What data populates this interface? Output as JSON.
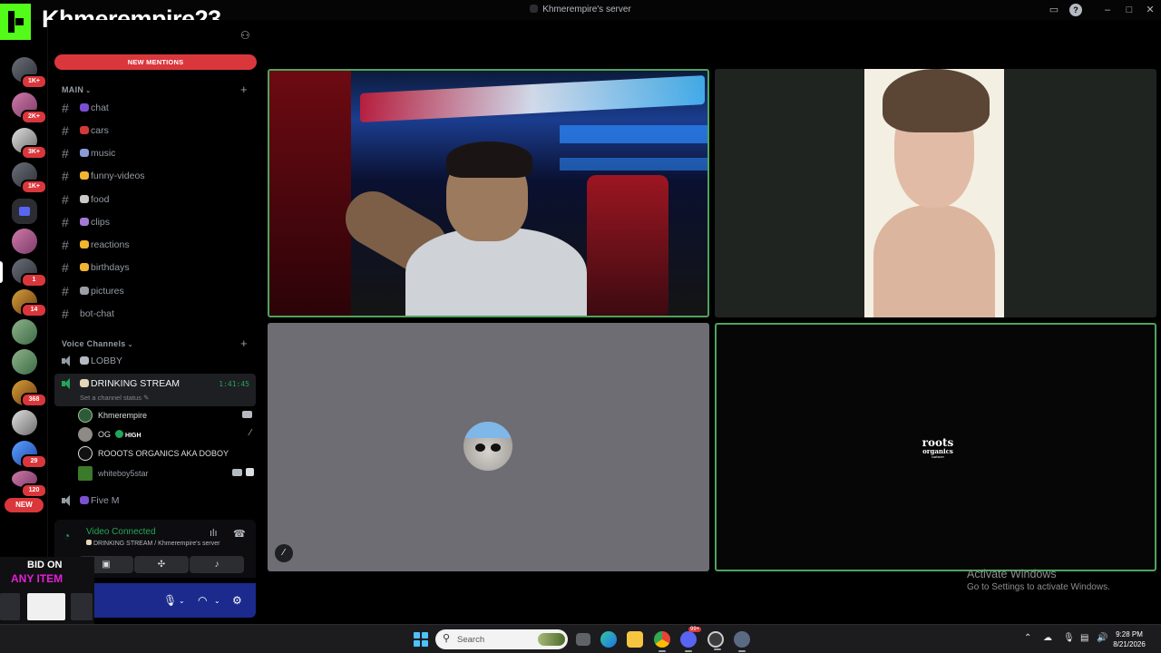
{
  "window": {
    "title": "Khmerempire's server"
  },
  "overlay": {
    "streamer_name": "Khmerempire23",
    "bid_line1": "BID ON",
    "bid_line2": "ANY ITEM"
  },
  "rail": {
    "badges": [
      "1K+",
      "2K+",
      "3K+",
      "1K+",
      "1",
      "14",
      "368",
      "29",
      "120"
    ],
    "new_label": "NEW"
  },
  "sidebar": {
    "new_mentions": "NEW MENTIONS",
    "category_main": "MAIN",
    "text_channels": [
      {
        "name": "chat",
        "emoji_color": "#7b4fd1"
      },
      {
        "name": "cars",
        "emoji_color": "#d23a3a"
      },
      {
        "name": "music",
        "emoji_color": "#8a9ad6"
      },
      {
        "name": "funny-videos",
        "emoji_color": "#f1b531"
      },
      {
        "name": "food",
        "emoji_color": "#c9c9c9"
      },
      {
        "name": "clips",
        "emoji_color": "#a57ad6"
      },
      {
        "name": "reactions",
        "emoji_color": "#f1b531"
      },
      {
        "name": "birthdays",
        "emoji_color": "#f1b531"
      },
      {
        "name": "pictures",
        "emoji_color": "#9aa0a6"
      },
      {
        "name": "bot-chat",
        "emoji_color": ""
      }
    ],
    "category_voice": "Voice Channels",
    "voice_channels": {
      "lobby": "LOBBY",
      "drinking": "DRINKING STREAM",
      "drinking_timer": "1:41:45",
      "set_status": "Set a channel status",
      "members": [
        {
          "name": "Khmerempire",
          "tag": ""
        },
        {
          "name": "OG",
          "tag": "HIGH"
        },
        {
          "name": "ROOOTS ORGANICS AKA DOBOY",
          "tag": ""
        },
        {
          "name": "whiteboy5star",
          "tag": ""
        }
      ],
      "five_m": "Five M"
    }
  },
  "voice_panel": {
    "status": "Video Connected",
    "location": "DRINKING STREAM / Khmerempire's server"
  },
  "video": {
    "tile4_logo_line1": "roots",
    "tile4_logo_line2": "organics",
    "tile4_logo_line3": "nature"
  },
  "watermark": {
    "line1": "Activate Windows",
    "line2": "Go to Settings to activate Windows."
  },
  "taskbar": {
    "search_placeholder": "Search",
    "time": "9:28 PM",
    "date": "8/21/2026",
    "discord_badge": "99+"
  },
  "colors": {
    "mentions_red": "#da373c",
    "speaking_green": "#4fa35d",
    "connected_green": "#23a55a",
    "user_panel_blue": "#1b2a8c"
  }
}
